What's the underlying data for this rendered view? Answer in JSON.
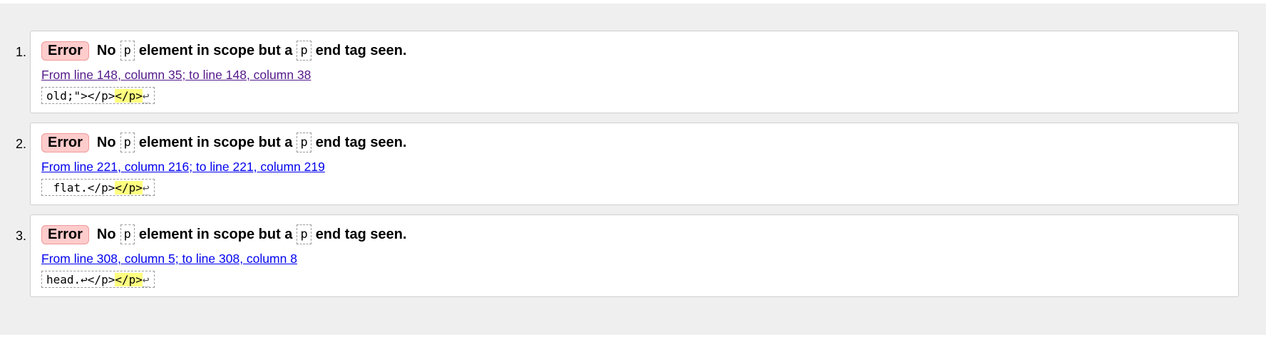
{
  "messages": [
    {
      "number": "1.",
      "type_label": "Error",
      "text_before": "No",
      "code_1": "p",
      "text_middle": "element in scope but a",
      "code_2": "p",
      "text_after": "end tag seen.",
      "location": "From line 148, column 35; to line 148, column 38",
      "location_visited": true,
      "extract_before": "old;\"></p>",
      "extract_highlight": "</p>",
      "extract_after": "↩"
    },
    {
      "number": "2.",
      "type_label": "Error",
      "text_before": "No",
      "code_1": "p",
      "text_middle": "element in scope but a",
      "code_2": "p",
      "text_after": "end tag seen.",
      "location": "From line 221, column 216; to line 221, column 219",
      "location_visited": false,
      "extract_before": " flat.</p>",
      "extract_highlight": "</p>",
      "extract_after": "↩"
    },
    {
      "number": "3.",
      "type_label": "Error",
      "text_before": "No",
      "code_1": "p",
      "text_middle": "element in scope but a",
      "code_2": "p",
      "text_after": "end tag seen.",
      "location": "From line 308, column 5; to line 308, column 8",
      "location_visited": false,
      "extract_before": "head.↩</p>",
      "extract_highlight": "</p>",
      "extract_after": "↩"
    }
  ],
  "colors": {
    "error_badge_bg": "#ffcccc",
    "highlight": "#ffff80",
    "link": "#0000ee",
    "link_visited": "#551a8b",
    "panel_bg": "#efefef"
  }
}
